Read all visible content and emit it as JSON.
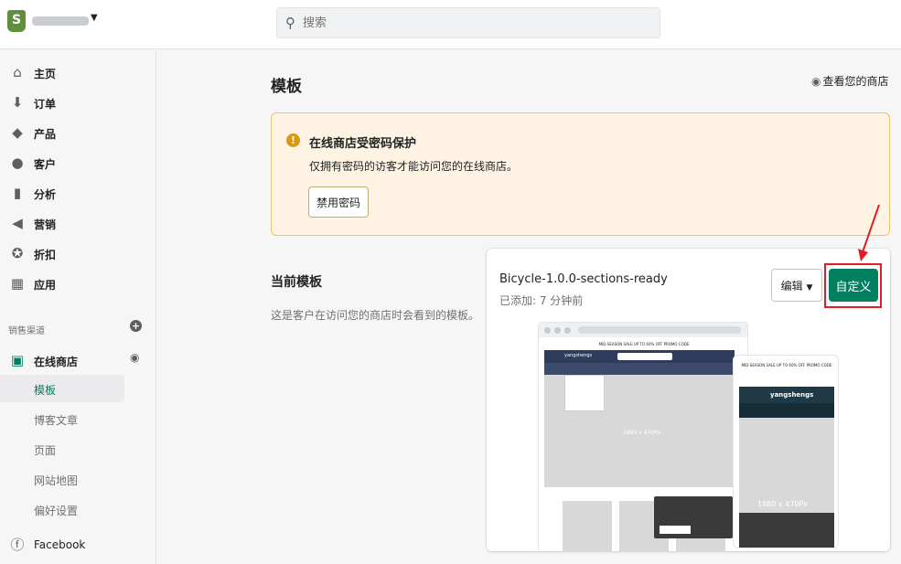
{
  "topbar": {
    "search_placeholder": "搜索"
  },
  "sidebar": {
    "items": [
      {
        "label": "主页",
        "icon": "home-icon",
        "glyph": "⌂"
      },
      {
        "label": "订单",
        "icon": "orders-icon",
        "glyph": "⬇"
      },
      {
        "label": "产品",
        "icon": "tag-icon",
        "glyph": "◆"
      },
      {
        "label": "客户",
        "icon": "person-icon",
        "glyph": "●"
      },
      {
        "label": "分析",
        "icon": "analytics-icon",
        "glyph": "▮"
      },
      {
        "label": "营销",
        "icon": "megaphone-icon",
        "glyph": "◀"
      },
      {
        "label": "折扣",
        "icon": "discount-icon",
        "glyph": "✪"
      },
      {
        "label": "应用",
        "icon": "apps-icon",
        "glyph": "▦"
      }
    ],
    "section_label": "销售渠道",
    "online_store": "在线商店",
    "sub_items": [
      "模板",
      "博客文章",
      "页面",
      "网站地图",
      "偏好设置"
    ],
    "active_sub": "模板",
    "facebook": "Facebook"
  },
  "main": {
    "page_title": "模板",
    "view_store": "查看您的商店",
    "banner": {
      "title": "在线商店受密码保护",
      "description": "仅拥有密码的访客才能访问您的在线商店。",
      "button": "禁用密码"
    },
    "current_theme": {
      "title": "当前模板",
      "description": "这是客户在访问您的商店时会看到的模板。",
      "theme_name": "Bicycle-1.0.0-sections-ready",
      "added": "已添加: 7 分钟前",
      "edit_button": "编辑",
      "customize_button": "自定义"
    },
    "preview": {
      "desktop_promo": "MID-SEASON SALE UP TO 60% OFF PROMO CODE",
      "desktop_store": "yangshengs",
      "desktop_hero": "1880 x 470Px",
      "mobile_promo": "MID-SEASON SALE UP TO 60% OFF PROMO CODE",
      "mobile_store": "yangshengs",
      "mobile_hero": "1880 x 470Px"
    }
  },
  "colors": {
    "primary": "#008060",
    "banner_bg": "#fff4e4",
    "banner_border": "#f0c06e",
    "warning": "#d89a11",
    "highlight": "#e11d25"
  }
}
